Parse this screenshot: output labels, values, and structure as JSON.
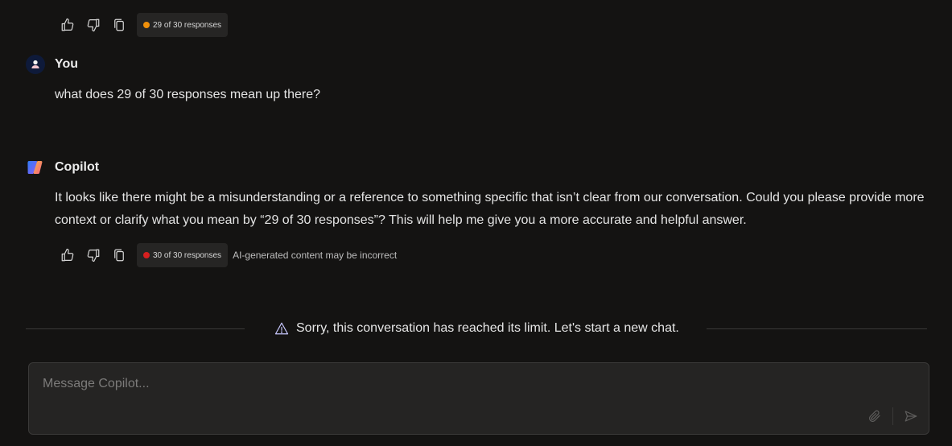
{
  "top_actions": {
    "badge_text": "29 of 30 responses",
    "dot_color": "#f0900a"
  },
  "user_message": {
    "author": "You",
    "text": "what does 29 of 30 responses mean up there?"
  },
  "copilot_message": {
    "author": "Copilot",
    "line1": "It looks like there might be a misunderstanding or a reference to something specific that isn’t clear from our conversation. Could you please provide more",
    "line2": "context or clarify what you mean by “29 of 30 responses”? This will help me give you a more accurate and helpful answer."
  },
  "copilot_actions": {
    "badge_text": "30 of 30 responses",
    "dot_color": "#d61f1f",
    "note": "AI-generated content may be incorrect"
  },
  "icons": {
    "like": "thumbs-up-icon",
    "dislike": "thumbs-down-icon",
    "copy": "copy-icon",
    "warning": "warning-triangle-icon",
    "attach": "paperclip-icon",
    "send": "send-icon"
  },
  "limit_notice": {
    "text": "Sorry, this conversation has reached its limit. Let's start a new chat."
  },
  "composer": {
    "placeholder": "Message Copilot..."
  }
}
